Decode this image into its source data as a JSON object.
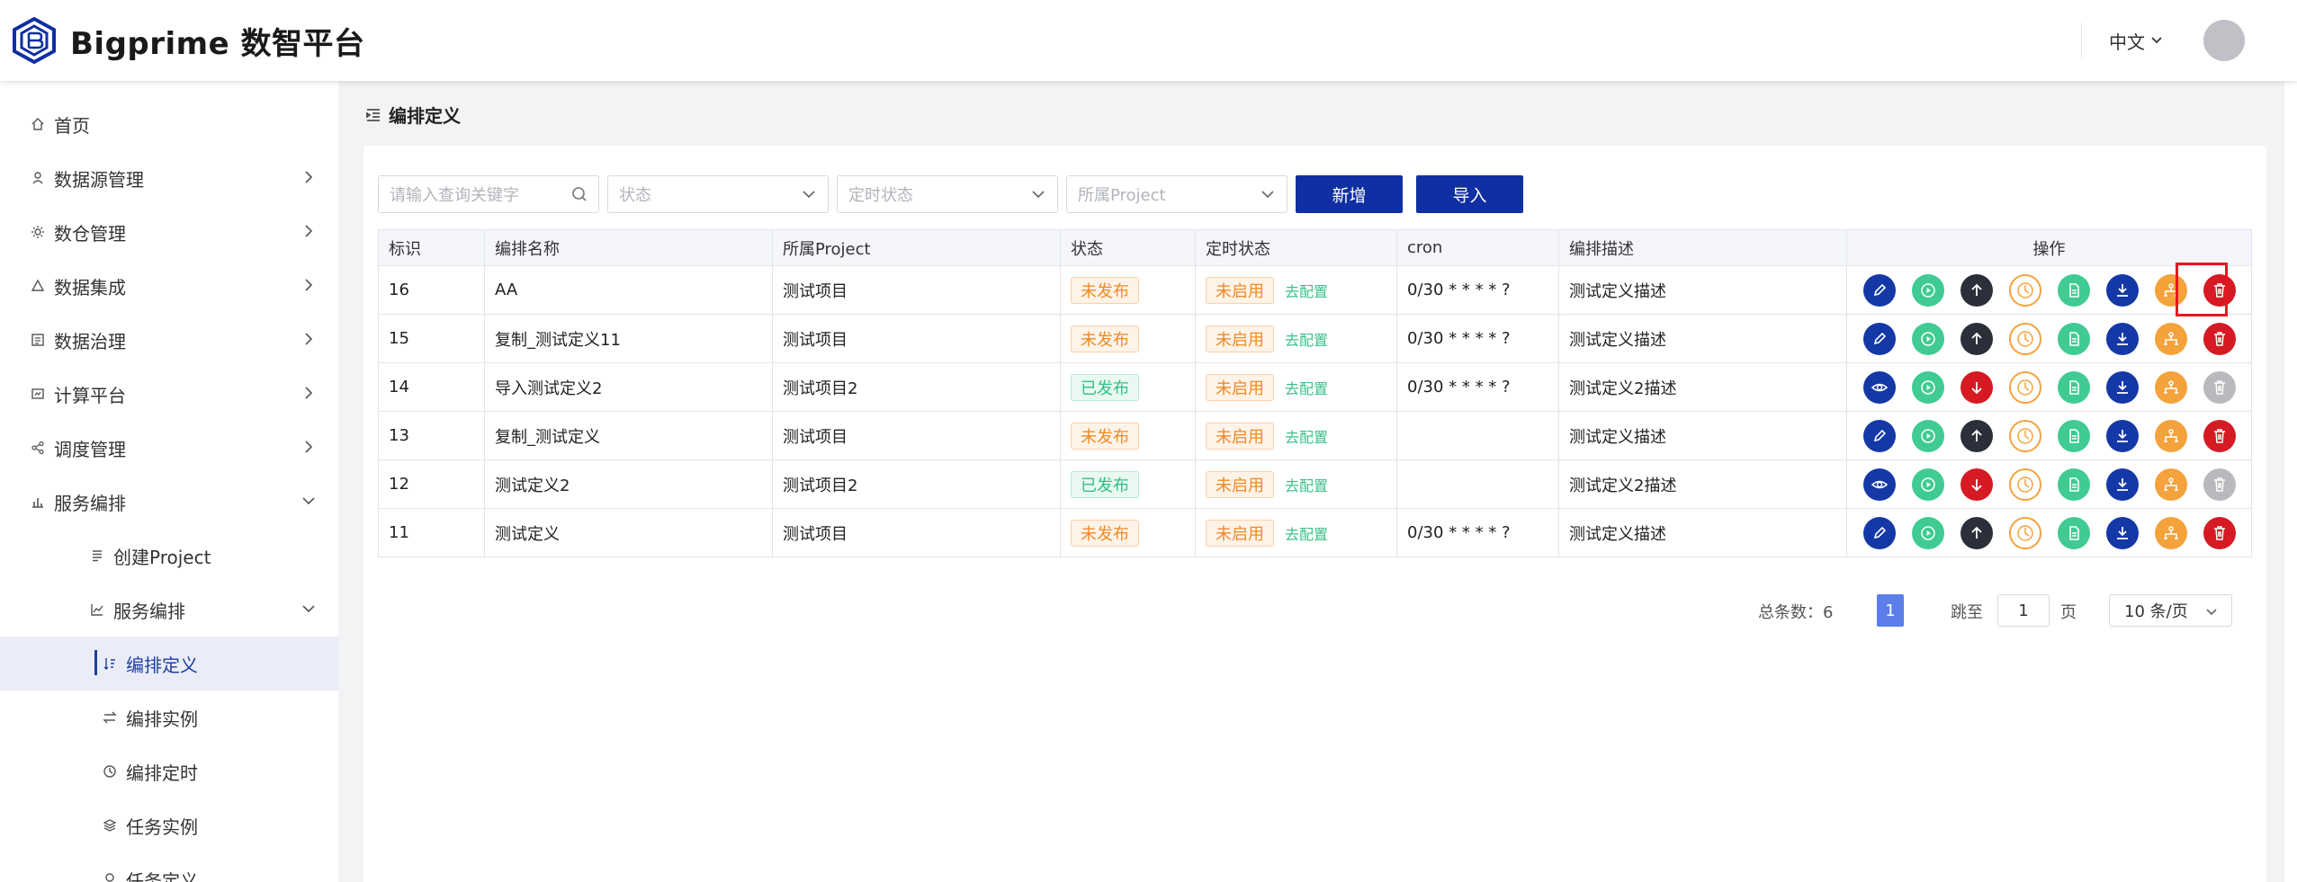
{
  "app": {
    "title": "Bigprime 数智平台",
    "language": "中文"
  },
  "sidebar": {
    "items": [
      {
        "label": "首页",
        "icon": "home-icon"
      },
      {
        "label": "数据源管理",
        "icon": "datasource-icon"
      },
      {
        "label": "数仓管理",
        "icon": "warehouse-icon"
      },
      {
        "label": "数据集成",
        "icon": "integration-icon"
      },
      {
        "label": "数据治理",
        "icon": "governance-icon"
      },
      {
        "label": "计算平台",
        "icon": "compute-icon"
      },
      {
        "label": "调度管理",
        "icon": "schedule-icon"
      },
      {
        "label": "服务编排",
        "icon": "chart-bar-icon"
      },
      {
        "label": "创建Project",
        "icon": "list-icon"
      },
      {
        "label": "服务编排",
        "icon": "line-chart-icon"
      },
      {
        "label": "编排定义",
        "icon": "sort-icon"
      },
      {
        "label": "编排实例",
        "icon": "swap-icon"
      },
      {
        "label": "编排定时",
        "icon": "clock-icon"
      },
      {
        "label": "任务实例",
        "icon": "layers-icon"
      },
      {
        "label": "任务定义",
        "icon": "task-icon"
      }
    ]
  },
  "page": {
    "title": "编排定义"
  },
  "toolbar": {
    "search_placeholder": "请输入查询关键字",
    "status_placeholder": "状态",
    "timer_placeholder": "定时状态",
    "project_placeholder": "所属Project",
    "add_label": "新增",
    "import_label": "导入"
  },
  "table": {
    "headers": [
      "标识",
      "编排名称",
      "所属Project",
      "状态",
      "定时状态",
      "cron",
      "编排描述",
      "操作"
    ],
    "config_link": "去配置",
    "rows": [
      {
        "id": "16",
        "name": "AA",
        "project": "测试项目",
        "status": "未发布",
        "timer": "未启用",
        "cron": "0/30 * * * * ?",
        "desc": "测试定义描述"
      },
      {
        "id": "15",
        "name": "复制_测试定义11",
        "project": "测试项目",
        "status": "未发布",
        "timer": "未启用",
        "cron": "0/30 * * * * ?",
        "desc": "测试定义描述"
      },
      {
        "id": "14",
        "name": "导入测试定义2",
        "project": "测试项目2",
        "status": "已发布",
        "timer": "未启用",
        "cron": "0/30 * * * * ?",
        "desc": "测试定义2描述"
      },
      {
        "id": "13",
        "name": "复制_测试定义",
        "project": "测试项目",
        "status": "未发布",
        "timer": "未启用",
        "cron": "",
        "desc": "测试定义描述"
      },
      {
        "id": "12",
        "name": "测试定义2",
        "project": "测试项目2",
        "status": "已发布",
        "timer": "未启用",
        "cron": "",
        "desc": "测试定义2描述"
      },
      {
        "id": "11",
        "name": "测试定义",
        "project": "测试项目",
        "status": "未发布",
        "timer": "未启用",
        "cron": "0/30 * * * * ?",
        "desc": "测试定义描述"
      }
    ]
  },
  "pagination": {
    "total_label": "总条数：6",
    "current_page": "1",
    "jump_label": "跳至",
    "jump_value": "1",
    "page_suffix": "页",
    "page_size": "10 条/页"
  },
  "colors": {
    "primary": "#0f2fa3",
    "accent_green": "#3fcb92",
    "danger": "#d51a24",
    "warning": "#f4a23c"
  }
}
